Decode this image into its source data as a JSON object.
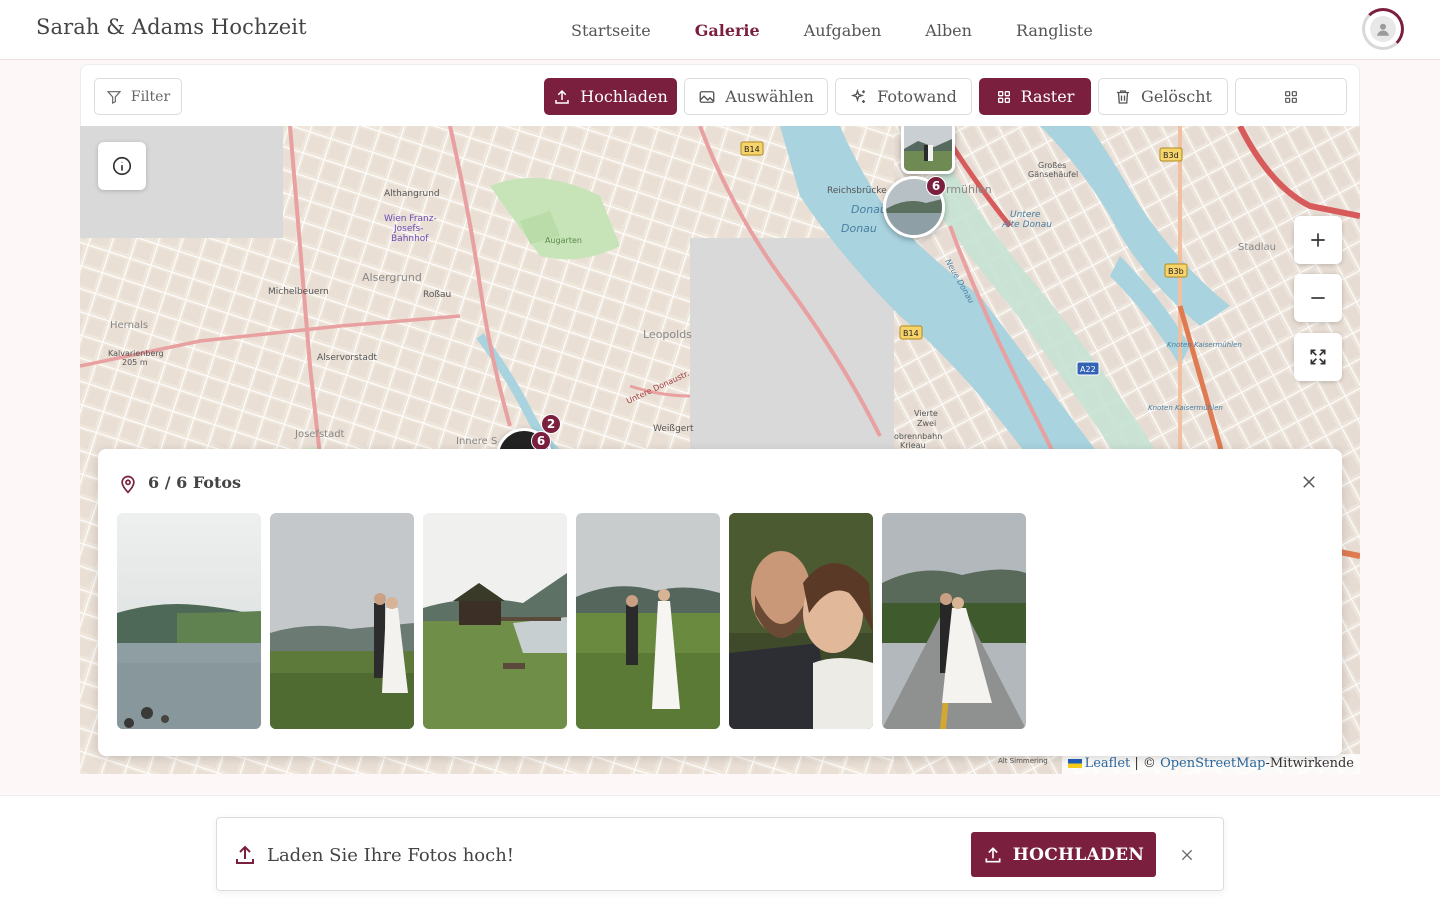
{
  "header": {
    "brand": "Sarah & Adams Hochzeit",
    "nav": [
      {
        "label": "Startseite",
        "active": false
      },
      {
        "label": "Galerie",
        "active": true
      },
      {
        "label": "Aufgaben",
        "active": false
      },
      {
        "label": "Alben",
        "active": false
      },
      {
        "label": "Rangliste",
        "active": false
      }
    ],
    "avatar_icon": "user-icon"
  },
  "toolbar": {
    "filter_label": "Filter",
    "upload_label": "Hochladen",
    "select_label": "Auswählen",
    "photowall_label": "Fotowand",
    "grid_label": "Raster",
    "deleted_label": "Gelöscht",
    "layout_icon": "grid-icon"
  },
  "map": {
    "labels": {
      "althangrund": "Althangrund",
      "wien_franz": "Wien Franz-",
      "josefs": "Josefs-",
      "bahnhof": "Bahnhof",
      "alsergrund": "Alsergrund",
      "rossau": "Roßau",
      "michelbeuern": "Michelbeuern",
      "hernals": "Hernals",
      "kalvarienberg": "Kalvarienberg",
      "kalvarienberg_height": "205 m",
      "alservorstadt": "Alservorstadt",
      "josefstadt": "Josefstadt",
      "innere": "Innere S",
      "leopolds": "Leopolds",
      "weissgerb": "Weißgert",
      "augarten": "Augarten",
      "reichsbrucke": "Reichsbrücke",
      "donau1": "Donau",
      "donau2": "Donau",
      "kaisermuhlen": "rmühlen",
      "untere_alte_donau": "Untere",
      "untere_alte_donau2": "Alte Donau",
      "stadlau": "Stadlau",
      "grosses": "Großes",
      "gansehaufel": "Gänsehäufel",
      "knoten1": "Knoten Kaisermühlen",
      "knoten2": "Knoten Kaisermühlen",
      "vierte": "Vierte",
      "zwei": "Zwei",
      "obrennbahn": "obrennbahn",
      "krieau": "Krieau",
      "neue_donau": "Neue Donau",
      "untere_donaustr": "Untere Donaustr.",
      "alt_simmering": "Alt Simmering",
      "b14a": "B14",
      "b14b": "B14",
      "b3d": "B3d",
      "b3b": "B3b",
      "a22": "A22"
    },
    "cluster_top_count": "6",
    "cluster_left_count_a": "2",
    "cluster_left_count_b": "6",
    "zoom_in_icon": "plus-icon",
    "zoom_out_icon": "minus-icon",
    "fullscreen_icon": "fullscreen-icon",
    "info_icon": "info-icon",
    "attribution": {
      "leaflet": "Leaflet",
      "separator": " | © ",
      "osm": "OpenStreetMap",
      "suffix": "-Mitwirkende"
    }
  },
  "photo_panel": {
    "title": "6 / 6 Fotos",
    "pin_icon": "map-pin-icon",
    "close_icon": "close-icon",
    "photos": [
      {
        "subject": "mountain lake"
      },
      {
        "subject": "couple in meadow"
      },
      {
        "subject": "wooden cabin by lake"
      },
      {
        "subject": "couple in grass"
      },
      {
        "subject": "couple close-up"
      },
      {
        "subject": "couple on road"
      }
    ]
  },
  "upload_banner": {
    "text": "Laden Sie Ihre Fotos hoch!",
    "button_label": "HOCHLADEN",
    "icon": "upload-icon",
    "close_icon": "close-icon"
  }
}
